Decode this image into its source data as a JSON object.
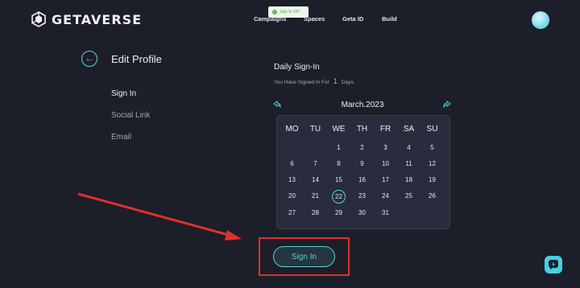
{
  "header": {
    "logo_text": "GETAVERSE",
    "nav": [
      "Campaigns",
      "Spaces",
      "Geta ID",
      "Build"
    ],
    "toast": "Sign in OK!"
  },
  "profile": {
    "title": "Edit Profile",
    "menu": [
      "Sign In",
      "Social Link",
      "Email"
    ],
    "active_menu": "Sign In"
  },
  "daily": {
    "title": "Daily Sign-In",
    "signed_prefix": "You Have Signed In For",
    "signed_count": "1",
    "signed_suffix": "Days.",
    "month_title": "March.2023",
    "weekdays": [
      "MO",
      "TU",
      "WE",
      "TH",
      "FR",
      "SA",
      "SU"
    ],
    "weeks": [
      [
        "",
        "",
        "1",
        "2",
        "3",
        "4",
        "5"
      ],
      [
        "6",
        "7",
        "8",
        "9",
        "10",
        "11",
        "12"
      ],
      [
        "13",
        "14",
        "15",
        "16",
        "17",
        "18",
        "19"
      ],
      [
        "20",
        "21",
        "22",
        "23",
        "24",
        "25",
        "26"
      ],
      [
        "27",
        "28",
        "29",
        "30",
        "31",
        "",
        ""
      ]
    ],
    "today": "22",
    "sign_in_button": "Sign In"
  },
  "colors": {
    "background": "#1c1e29",
    "accent": "#56d6cd",
    "annotation_red": "#e0302a",
    "calendar_bg": "#292c3c"
  },
  "icons": [
    "logo-icon",
    "back-arrow-icon",
    "prev-month-icon",
    "next-month-icon",
    "check-icon",
    "help-icon"
  ]
}
